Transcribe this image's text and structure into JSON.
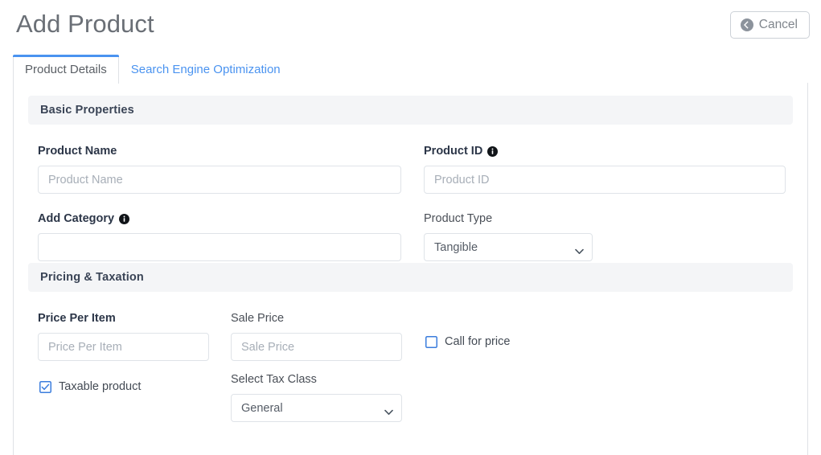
{
  "header": {
    "title": "Add Product",
    "cancel_label": "Cancel",
    "cancel_icon": "back-arrow-circle-icon"
  },
  "tabs": [
    {
      "label": "Product Details",
      "active": true
    },
    {
      "label": "Search Engine Optimization",
      "active": false
    }
  ],
  "colors": {
    "accent_blue": "#4a93f0",
    "link_blue": "#4a93f0",
    "section_band_bg": "#f4f5f7",
    "border": "#dfe2e6",
    "input_border": "#dfe3e8",
    "title_gray": "#6a6f76",
    "heading_navy": "#3a4456",
    "checkbox_blue": "#3b7ddd"
  },
  "sections": [
    {
      "id": "basic-properties",
      "title": "Basic Properties",
      "fields": {
        "product_name": {
          "label": "Product Name",
          "placeholder": "Product Name",
          "value": "",
          "bold": true,
          "info": false
        },
        "product_id": {
          "label": "Product ID",
          "placeholder": "Product ID",
          "value": "",
          "bold": true,
          "info": true,
          "info_icon": "info-icon"
        },
        "add_category": {
          "label": "Add Category",
          "placeholder": "",
          "value": "",
          "bold": true,
          "info": true,
          "info_icon": "info-icon"
        },
        "product_type": {
          "label": "Product Type",
          "value": "Tangible",
          "options": [
            "Tangible"
          ],
          "bold": false,
          "info": false
        }
      }
    },
    {
      "id": "pricing-taxation",
      "title": "Pricing & Taxation",
      "fields": {
        "price_per_item": {
          "label": "Price Per Item",
          "placeholder": "Price Per Item",
          "value": "",
          "bold": true
        },
        "sale_price": {
          "label": "Sale Price",
          "placeholder": "Sale Price",
          "value": "",
          "bold": false
        },
        "call_for_price": {
          "label": "Call for price",
          "checked": false
        },
        "taxable_product": {
          "label": "Taxable product",
          "checked": true
        },
        "select_tax_class": {
          "label": "Select Tax Class",
          "value": "General",
          "options": [
            "General"
          ],
          "bold": false
        }
      }
    }
  ]
}
